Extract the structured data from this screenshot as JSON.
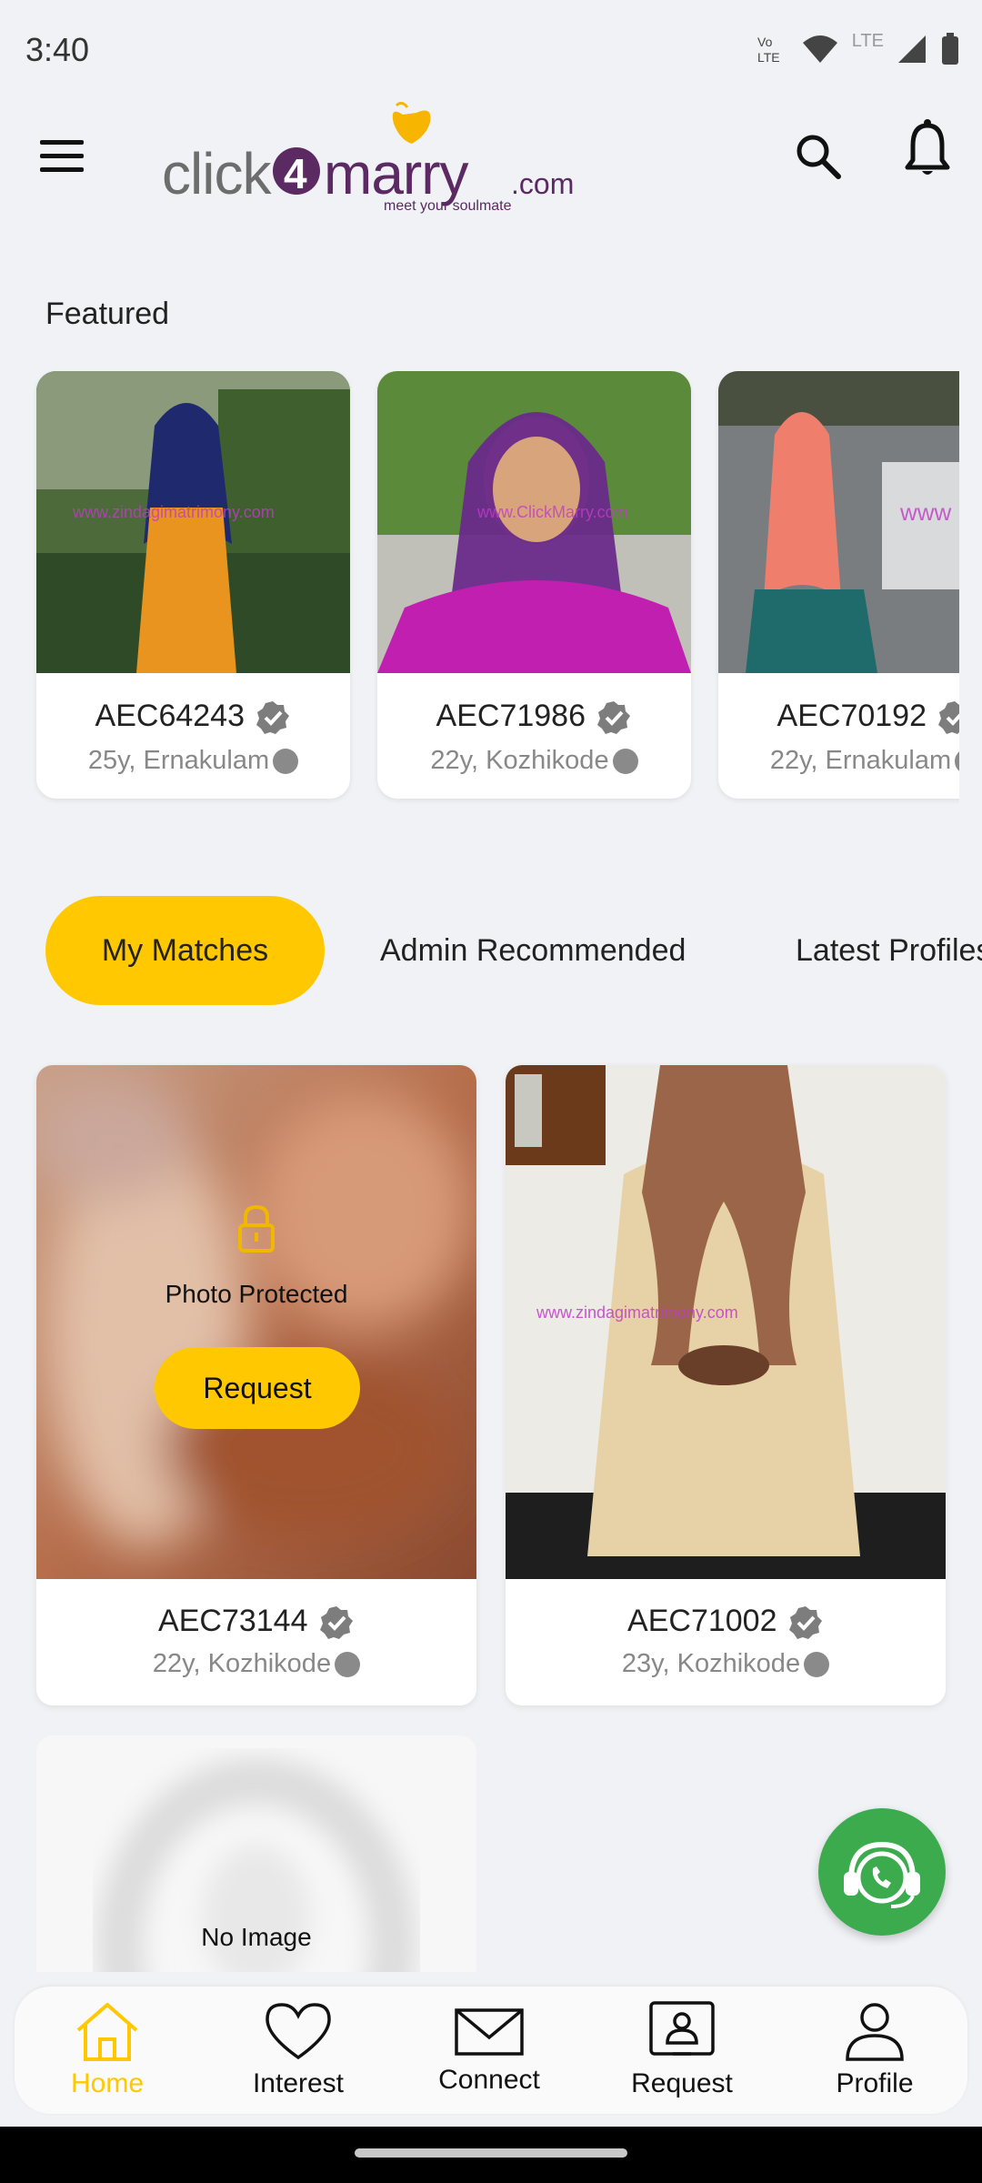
{
  "status_bar": {
    "time": "3:40",
    "network": "LTE"
  },
  "header": {
    "logo_text_left": "click",
    "logo_number": "4",
    "logo_text_right": "marry",
    "logo_suffix": ".com",
    "tagline": "meet your soulmate"
  },
  "featured": {
    "title": "Featured",
    "cards": [
      {
        "id": "AEC64243",
        "meta": "25y, Ernakulam",
        "watermark": "www.zindagimatrimony.com"
      },
      {
        "id": "AEC71986",
        "meta": "22y, Kozhikode",
        "watermark": "www.ClickMarry.com"
      },
      {
        "id": "AEC70192",
        "meta": "22y, Ernakulam",
        "watermark": "www"
      }
    ]
  },
  "tabs": [
    {
      "label": "My Matches",
      "active": true
    },
    {
      "label": "Admin Recommended",
      "active": false
    },
    {
      "label": "Latest Profiles",
      "active": false
    }
  ],
  "matches": [
    {
      "id": "AEC73144",
      "meta": "22y, Kozhikode",
      "protected_text": "Photo Protected",
      "request_label": "Request"
    },
    {
      "id": "AEC71002",
      "meta": "23y, Kozhikode",
      "watermark": "www.zindagimatrimony.com"
    }
  ],
  "no_image_card": {
    "text": "No Image"
  },
  "bottom_nav": [
    {
      "label": "Home",
      "icon": "home-icon",
      "active": true
    },
    {
      "label": "Interest",
      "icon": "heart-icon",
      "active": false
    },
    {
      "label": "Connect",
      "icon": "mail-icon",
      "active": false
    },
    {
      "label": "Request",
      "icon": "request-icon",
      "active": false
    },
    {
      "label": "Profile",
      "icon": "profile-icon",
      "active": false
    }
  ],
  "colors": {
    "accent": "#ffc800",
    "brand_purple": "#5b2a62",
    "whatsapp": "#3bab4e"
  }
}
